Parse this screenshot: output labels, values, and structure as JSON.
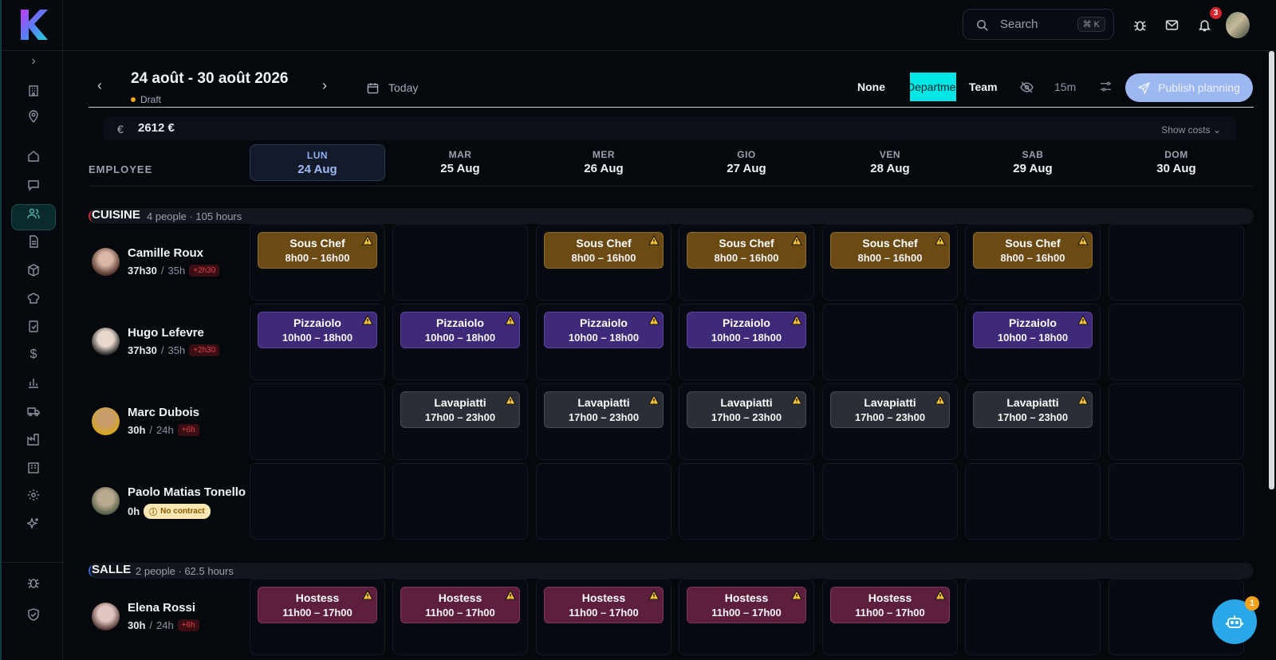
{
  "topbar": {
    "search_placeholder": "Search",
    "search_kbd": "⌘ K",
    "notification_count": "3"
  },
  "header": {
    "week": "24 août - 30 août 2026",
    "status": "Draft",
    "today": "Today",
    "group_by": [
      "None",
      "Department",
      "Team"
    ],
    "group_by_selected": "Department",
    "interval": "15m",
    "publish": "Publish planning"
  },
  "costs": {
    "currency_icon": "€",
    "total": "2612 €",
    "toggle": "Show costs"
  },
  "grid": {
    "employee_header": "EMPLOYEE",
    "days": [
      {
        "dow": "LUN",
        "date": "24 Aug",
        "active": true
      },
      {
        "dow": "MAR",
        "date": "25 Aug"
      },
      {
        "dow": "MER",
        "date": "26 Aug"
      },
      {
        "dow": "GIO",
        "date": "27 Aug"
      },
      {
        "dow": "VEN",
        "date": "28 Aug"
      },
      {
        "dow": "SAB",
        "date": "29 Aug"
      },
      {
        "dow": "DOM",
        "date": "30 Aug"
      }
    ]
  },
  "departments": [
    {
      "name": "CUISINE",
      "meta": "4 people · 105 hours",
      "color": "#d3262e"
    },
    {
      "name": "SALLE",
      "meta": "2 people · 62.5 hours",
      "color": "#2f6bd8"
    }
  ],
  "employees": [
    {
      "name": "Camille Roux",
      "worked": "37h30",
      "contract": "35h",
      "over": "+2h30"
    },
    {
      "name": "Hugo Lefevre",
      "worked": "37h30",
      "contract": "35h",
      "over": "+2h30"
    },
    {
      "name": "Marc Dubois",
      "worked": "30h",
      "contract": "24h",
      "over": "+6h"
    },
    {
      "name": "Paolo Matias Tonello",
      "worked": "0h",
      "badge": "No contract"
    },
    {
      "name": "Elena Rossi",
      "worked": "30h",
      "contract": "24h",
      "over": "+6h"
    }
  ],
  "shifts": {
    "chef": {
      "role": "Sous Chef",
      "time": "8h00 – 16h00"
    },
    "pizza": {
      "role": "Pizzaiolo",
      "time": "10h00 – 18h00"
    },
    "lava": {
      "role": "Lavapiatti",
      "time": "17h00 – 23h00"
    },
    "host": {
      "role": "Hostess",
      "time": "11h00 – 17h00"
    }
  },
  "assistant": {
    "badge": "1"
  }
}
